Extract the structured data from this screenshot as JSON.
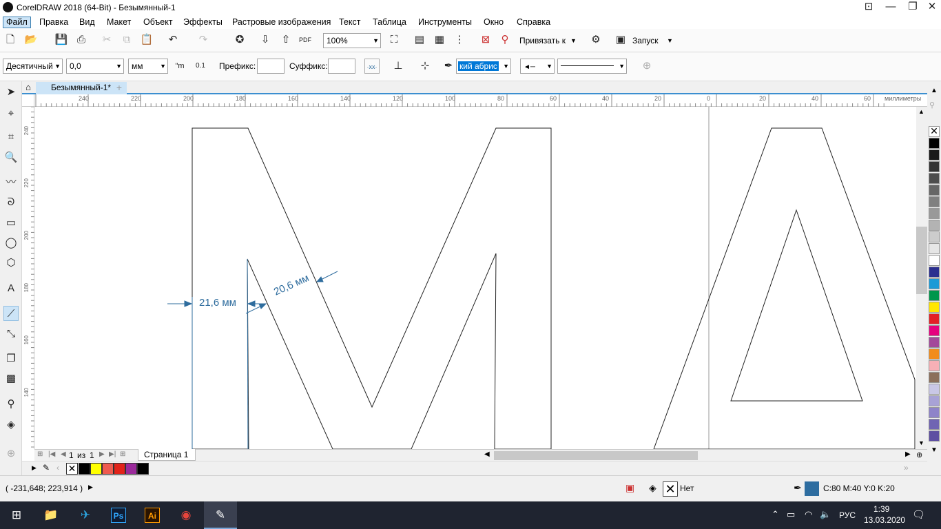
{
  "window": {
    "title": "CorelDRAW 2018 (64-Bit) - Безымянный-1"
  },
  "menu": [
    "Файл",
    "Правка",
    "Вид",
    "Макет",
    "Объект",
    "Эффекты",
    "Растровые изображения",
    "Текст",
    "Таблица",
    "Инструменты",
    "Окно",
    "Справка"
  ],
  "toolbar": {
    "zoom": "100%",
    "snap_label": "Привязать к",
    "launch_label": "Запуск"
  },
  "properties": {
    "units_style": "Десятичный",
    "precision": "0,0",
    "units": "мм",
    "prefix_label": "Префикс:",
    "prefix_value": "",
    "suffix_label": "Суффикс:",
    "suffix_value": "",
    "outline_label": "кий абрис"
  },
  "tabs": {
    "document": "Безымянный-1*"
  },
  "ruler": {
    "h_ticks": [
      "240",
      "220",
      "200",
      "180",
      "160",
      "140",
      "120",
      "100",
      "80",
      "60",
      "40",
      "20",
      "0",
      "20",
      "40",
      "60"
    ],
    "h_unit": "миллиметры",
    "v_ticks": [
      "240",
      "220",
      "200",
      "180",
      "160",
      "140"
    ]
  },
  "dimensions": {
    "dim1": "21,6 мм",
    "dim2": "20,6 мм"
  },
  "page_nav": {
    "current": "1",
    "of": "из",
    "total": "1",
    "page_tab": "Страница 1"
  },
  "status": {
    "coords": "( -231,648; 223,914 )",
    "fill_label": "Нет",
    "outline_color": "C:80 M:40 Y:0 K:20"
  },
  "taskbar": {
    "lang": "РУС",
    "time": "1:39",
    "date": "13.03.2020"
  },
  "colors": {
    "accent": "#3c7fb1",
    "dimension": "#2f6d9e",
    "outline_swatch": "#2e6da0"
  },
  "palette": [
    "#000000",
    "#1a1a1a",
    "#333333",
    "#4d4d4d",
    "#666666",
    "#808080",
    "#999999",
    "#b3b3b3",
    "#cccccc",
    "#e6e6e6",
    "#ffffff",
    "#2b2f8f",
    "#1c9ad6",
    "#00964c",
    "#ffe600",
    "#e31f26",
    "#e5007e",
    "#a3499a",
    "#f28c1c",
    "#f7b0b6",
    "#8b6f5b",
    "#c9c7e6",
    "#a8a2d6",
    "#8e83c9",
    "#7064b3",
    "#5d4fa2"
  ],
  "doc_palette": [
    "#000000",
    "#ffff00",
    "#ee5a4f",
    "#e2231a",
    "#9b2a9b",
    "#000000"
  ]
}
